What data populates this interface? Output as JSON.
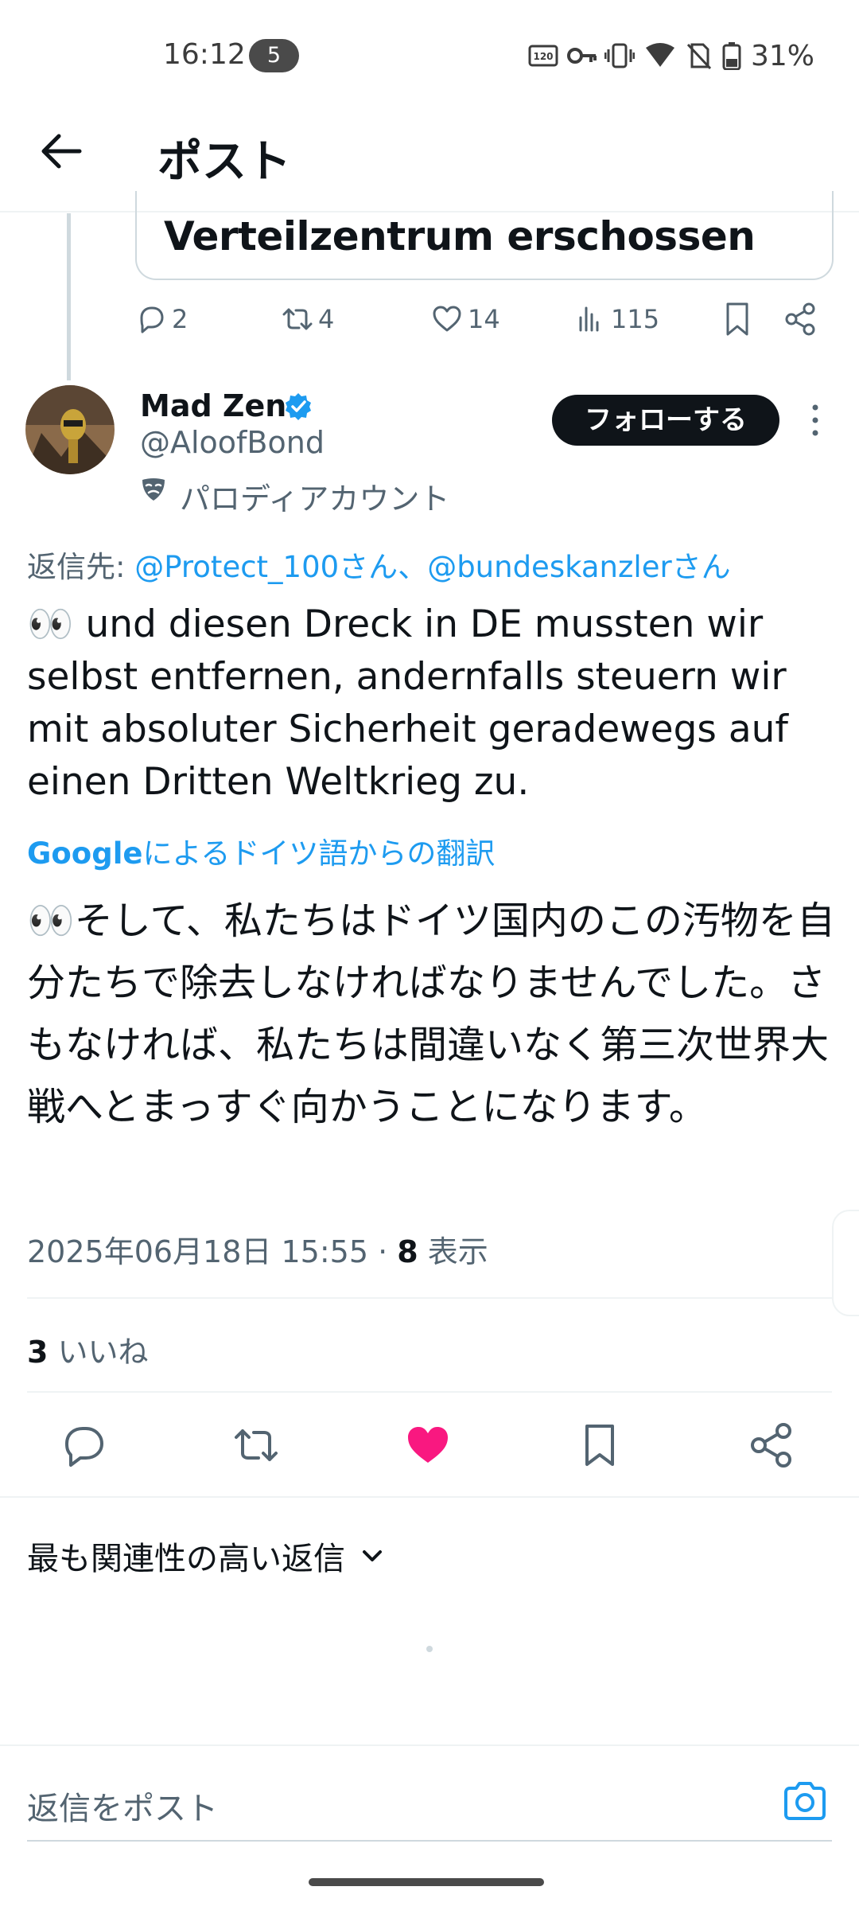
{
  "status_bar": {
    "time": "16:12",
    "notification_count": "5",
    "battery_percent": "31%"
  },
  "header": {
    "title": "ポスト"
  },
  "quoted_card": {
    "headline": "Verteilzentrum erschossen",
    "replies": "2",
    "reposts": "4",
    "likes": "14",
    "views": "115"
  },
  "author": {
    "name": "Mad Zen",
    "handle": "@AloofBond",
    "parody_label": "パロディアカウント",
    "follow_label": "フォローする"
  },
  "reply_to": {
    "prefix": "返信先: ",
    "mention_1": "@Protect_100さん",
    "separator": "、",
    "mention_2": "@bundeskanzlerさん"
  },
  "tweet": {
    "text": "👀 und diesen Dreck in DE mussten wir selbst entfernen, andernfalls steuern wir mit absoluter Sicherheit geradewegs auf einen Dritten Weltkrieg zu.",
    "translation_brand": "Google",
    "translation_label": "によるドイツ語からの翻訳",
    "translated_text": "👀そして、私たちはドイツ国内のこの汚物を自分たちで除去しなければなりませんでした。さもなければ、私たちは間違いなく第三次世界大戦へとまっすぐ向かうことになります。",
    "timestamp": "2025年06月18日 15:55 · ",
    "views_count": "8",
    "views_label": " 表示",
    "likes_count": "3",
    "likes_label": " いいね"
  },
  "replies_sort": {
    "label": "最も関連性の高い返信"
  },
  "reply_bar": {
    "placeholder": "返信をポスト"
  },
  "colors": {
    "accent_blue": "#1d9bf0",
    "like_pink": "#f91880",
    "text_primary": "#0f1419",
    "text_secondary": "#536471"
  }
}
